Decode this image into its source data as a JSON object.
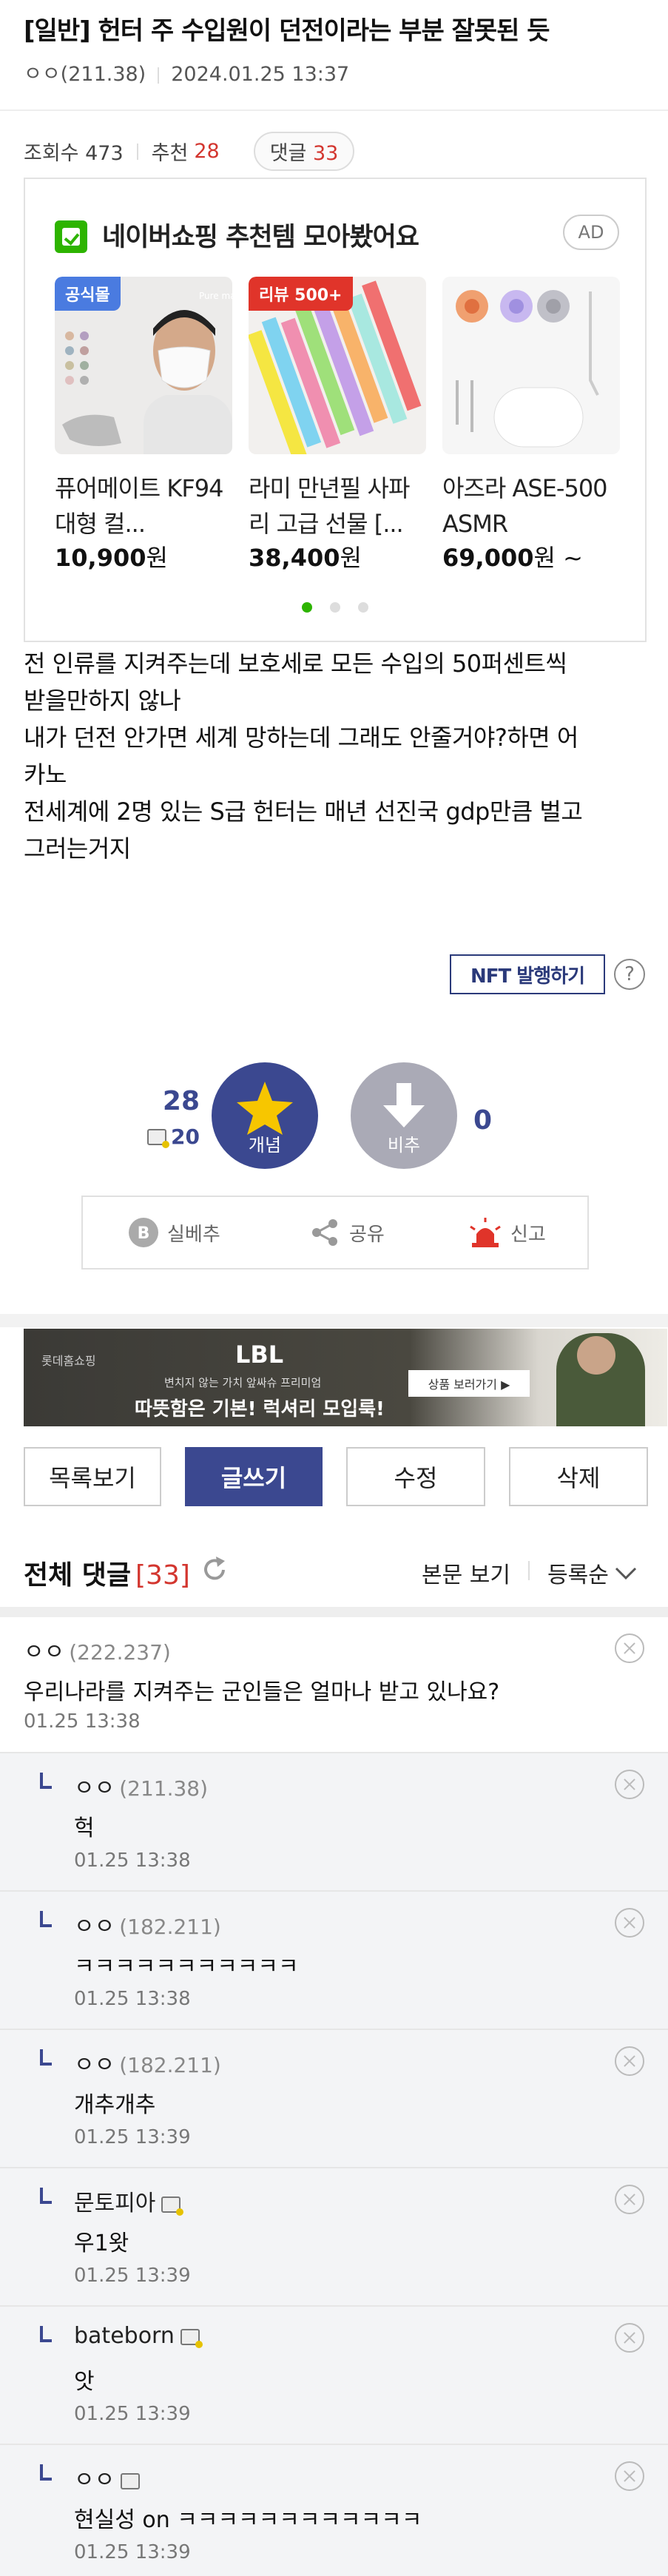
{
  "post": {
    "title": "[일반] 헌터 주 수입원이 던전이라는 부분 잘못된 듯",
    "author": "ㅇㅇ(211.38)",
    "date": "2024.01.25 13:37",
    "views_label": "조회수 473",
    "recommend_label": "추천",
    "recommend_count": "28",
    "comments_label": "댓글",
    "comments_count": "33"
  },
  "ad": {
    "title": "네이버쇼핑 추천템 모아봤어요",
    "badge": "AD",
    "products": [
      {
        "tag": "공식몰",
        "name": "퓨어메이트 KF94 대형 컬...",
        "price": "10,900",
        "unit": "원",
        "tag_color": "#4a7be0"
      },
      {
        "tag": "리뷰 500+",
        "name": "라미 만년필 사파리 고급 선물 [...",
        "price": "38,400",
        "unit": "원",
        "tag_color": "#e0342a"
      },
      {
        "tag": "",
        "name": "아즈라 ASE-500 ASMR",
        "price": "69,000",
        "unit": "원 ~",
        "tag_color": ""
      }
    ]
  },
  "body": {
    "lines": [
      "전 인류를 지켜주는데 보호세로 모든 수입의 50퍼센트씩",
      "받을만하지 않나",
      "내가 던전 안가면 세계 망하는데 그래도 안줄거야?하면 어",
      "카노",
      "전세계에 2명 있는 S급 헌터는 매년 선진국 gdp만큼 벌고",
      "그러는거지"
    ]
  },
  "nft_button": "NFT 발행하기",
  "help": "?",
  "vote": {
    "up_count": "28",
    "up_sub": "20",
    "up_label": "개념",
    "down_label": "비추",
    "down_count": "0"
  },
  "actions": {
    "report_best": "실베추",
    "share": "공유",
    "report": "신고"
  },
  "banner": {
    "brand": "롯데홈쇼핑",
    "title": "LBL",
    "line1": "변치지 않는 가치 앞싸슈 프리미엄",
    "line2": "따뜻함은 기본! 럭셔리 모입룩!",
    "cta": "상품 보러가기 ▶"
  },
  "buttons": {
    "list": "목록보기",
    "write": "글쓰기",
    "edit": "수정",
    "delete": "삭제"
  },
  "comments_header": {
    "title": "전체 댓글",
    "count": "[33]",
    "view_main": "본문 보기",
    "sort": "등록순"
  },
  "comments": [
    {
      "nick": "ㅇㅇ",
      "ip": "(222.237)",
      "text": "우리나라를 지켜주는 군인들은 얼마나 받고 있나요?",
      "time": "01.25 13:38",
      "reply": false,
      "icon": ""
    },
    {
      "nick": "ㅇㅇ",
      "ip": "(211.38)",
      "text": "헉",
      "time": "01.25 13:38",
      "reply": true,
      "icon": ""
    },
    {
      "nick": "ㅇㅇ",
      "ip": "(182.211)",
      "text": "ㅋㅋㅋㅋㅋㅋㅋㅋㅋㅋㅋ",
      "time": "01.25 13:38",
      "reply": true,
      "icon": ""
    },
    {
      "nick": "ㅇㅇ",
      "ip": "(182.211)",
      "text": "개추개추",
      "time": "01.25 13:39",
      "reply": true,
      "icon": ""
    },
    {
      "nick": "문토피아",
      "ip": "",
      "text": "우1왓",
      "time": "01.25 13:39",
      "reply": true,
      "icon": "gold"
    },
    {
      "nick": "bateborn",
      "ip": "",
      "text": "앗",
      "time": "01.25 13:39",
      "reply": true,
      "icon": "gold"
    },
    {
      "nick": "ㅇㅇ",
      "ip": "",
      "text": "현실성 on ㅋㅋㅋㅋㅋㅋㅋㅋㅋㅋㅋㅋ",
      "time": "01.25 13:39",
      "reply": true,
      "icon": "plain"
    }
  ]
}
